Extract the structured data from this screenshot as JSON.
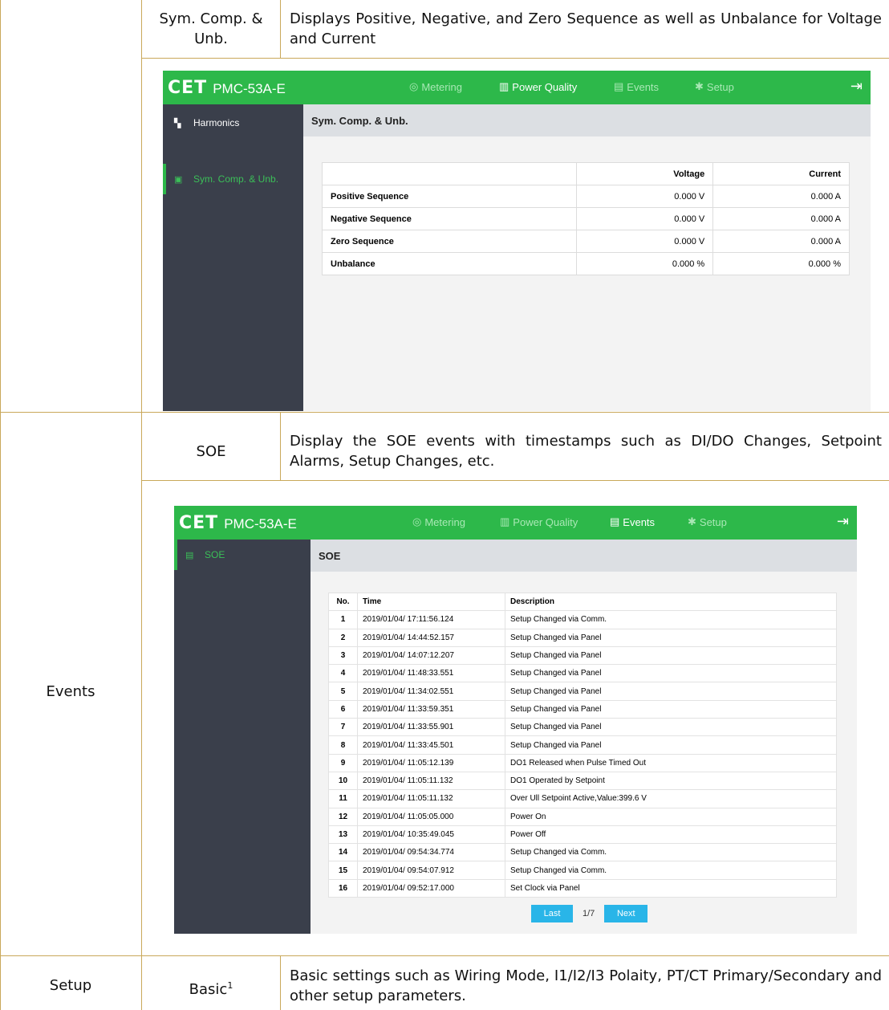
{
  "rows": {
    "sym": {
      "sub": "Sym. Comp. & Unb.",
      "desc": "Displays Positive, Negative, and Zero Sequence as well as Unbalance for Voltage and Current"
    },
    "events": {
      "group": "Events",
      "sub": "SOE",
      "desc": "Display the SOE events with timestamps such as DI/DO Changes, Setpoint Alarms, Setup Changes, etc."
    },
    "setup": {
      "group": "Setup",
      "sub": "Basic",
      "sup": "1",
      "desc": "Basic settings such as Wiring Mode, I1/I2/I3 Polaity, PT/CT Primary/Secondary and other setup parameters."
    }
  },
  "app": {
    "logo": "CET",
    "model": "PMC-53A-E",
    "nav": [
      "Metering",
      "Power Quality",
      "Events",
      "Setup"
    ]
  },
  "colors": {
    "topbar": "#2db84a",
    "sidebar": "#3a3f4b",
    "pager_button": "#29b5e8",
    "table_rule": "#c9a85a"
  },
  "shot1": {
    "sidebar_items": [
      "Harmonics",
      "Sym. Comp. & Unb."
    ],
    "active_nav": "Power Quality",
    "page_title": "Sym. Comp. & Unb.",
    "columns": [
      "",
      "Voltage",
      "Current"
    ],
    "rows": [
      {
        "label": "Positive Sequence",
        "voltage": "0.000 V",
        "current": "0.000 A"
      },
      {
        "label": "Negative Sequence",
        "voltage": "0.000 V",
        "current": "0.000 A"
      },
      {
        "label": "Zero Sequence",
        "voltage": "0.000 V",
        "current": "0.000 A"
      },
      {
        "label": "Unbalance",
        "voltage": "0.000 %",
        "current": "0.000 %"
      }
    ]
  },
  "shot2": {
    "sidebar_items": [
      "SOE"
    ],
    "active_nav": "Events",
    "page_title": "SOE",
    "columns": [
      "No.",
      "Time",
      "Description"
    ],
    "events": [
      {
        "no": "1",
        "time": "2019/01/04/ 17:11:56.124",
        "desc": "Setup Changed via Comm."
      },
      {
        "no": "2",
        "time": "2019/01/04/ 14:44:52.157",
        "desc": "Setup Changed via Panel"
      },
      {
        "no": "3",
        "time": "2019/01/04/ 14:07:12.207",
        "desc": "Setup Changed via Panel"
      },
      {
        "no": "4",
        "time": "2019/01/04/ 11:48:33.551",
        "desc": "Setup Changed via Panel"
      },
      {
        "no": "5",
        "time": "2019/01/04/ 11:34:02.551",
        "desc": "Setup Changed via Panel"
      },
      {
        "no": "6",
        "time": "2019/01/04/ 11:33:59.351",
        "desc": "Setup Changed via Panel"
      },
      {
        "no": "7",
        "time": "2019/01/04/ 11:33:55.901",
        "desc": "Setup Changed via Panel"
      },
      {
        "no": "8",
        "time": "2019/01/04/ 11:33:45.501",
        "desc": "Setup Changed via Panel"
      },
      {
        "no": "9",
        "time": "2019/01/04/ 11:05:12.139",
        "desc": "DO1 Released when Pulse Timed Out"
      },
      {
        "no": "10",
        "time": "2019/01/04/ 11:05:11.132",
        "desc": "DO1 Operated by Setpoint"
      },
      {
        "no": "11",
        "time": "2019/01/04/ 11:05:11.132",
        "desc": "Over Ull Setpoint Active,Value:399.6 V"
      },
      {
        "no": "12",
        "time": "2019/01/04/ 11:05:05.000",
        "desc": "Power On"
      },
      {
        "no": "13",
        "time": "2019/01/04/ 10:35:49.045",
        "desc": "Power Off"
      },
      {
        "no": "14",
        "time": "2019/01/04/ 09:54:34.774",
        "desc": "Setup Changed via Comm."
      },
      {
        "no": "15",
        "time": "2019/01/04/ 09:54:07.912",
        "desc": "Setup Changed via Comm."
      },
      {
        "no": "16",
        "time": "2019/01/04/ 09:52:17.000",
        "desc": "Set Clock via Panel"
      }
    ],
    "pager": {
      "last": "Last",
      "page": "1/7",
      "next": "Next"
    }
  }
}
